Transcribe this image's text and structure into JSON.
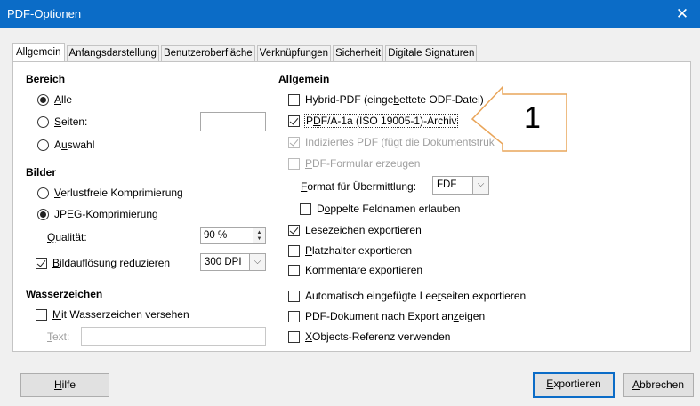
{
  "window": {
    "title": "PDF-Optionen",
    "close_symbol": "✕"
  },
  "tabs": [
    {
      "label": "Allgemein"
    },
    {
      "label": "Anfangsdarstellung"
    },
    {
      "label": "Benutzeroberfläche"
    },
    {
      "label": "Verknüpfungen"
    },
    {
      "label": "Sicherheit"
    },
    {
      "label": "Digitale Signaturen"
    }
  ],
  "left": {
    "bereich": {
      "heading": "Bereich",
      "alle": {
        "pre": "",
        "key": "A",
        "post": "lle",
        "selected": true
      },
      "seiten": {
        "pre": "",
        "key": "S",
        "post": "eiten:",
        "value": ""
      },
      "auswahl": {
        "pre": "A",
        "key": "u",
        "post": "swahl"
      }
    },
    "bilder": {
      "heading": "Bilder",
      "verlustfrei": {
        "pre": "",
        "key": "V",
        "post": "erlustfreie Komprimierung"
      },
      "jpeg": {
        "pre": "",
        "key": "J",
        "post": "PEG-Komprimierung",
        "selected": true
      },
      "qualitaet": {
        "pre": "",
        "key": "Q",
        "post": "ualität:",
        "value": "90 %"
      },
      "bildaufloesung": {
        "pre": "",
        "key": "B",
        "post": "ildauflösung reduzieren",
        "checked": true,
        "value": "300 DPI"
      }
    },
    "wasserzeichen": {
      "heading": "Wasserzeichen",
      "mit": {
        "pre": "",
        "key": "M",
        "post": "it Wasserzeichen versehen",
        "checked": false
      },
      "text": {
        "pre": "",
        "key": "T",
        "post": "ext:",
        "value": ""
      }
    }
  },
  "right": {
    "heading": "Allgemein",
    "hybrid": {
      "pre": "Hybrid-PDF (einge",
      "key": "b",
      "post": "ettete ODF-Datei)",
      "checked": false
    },
    "pdfa": {
      "pre": "P",
      "key": "D",
      "post": "F/A-1a (ISO 19005-1)-Archiv",
      "checked": true
    },
    "indiziert": {
      "pre": "",
      "key": "I",
      "post": "ndiziertes PDF (fügt die Dokumentstruk",
      "checked": true,
      "disabled": true
    },
    "formular": {
      "pre": "",
      "key": "P",
      "post": "DF-Formular erzeugen",
      "checked": false,
      "disabled": true
    },
    "format": {
      "pre": "",
      "key": "F",
      "post": "ormat für Übermittlung:",
      "value": "FDF"
    },
    "doppelte": {
      "pre": "D",
      "key": "o",
      "post": "ppelte Feldnamen erlauben",
      "checked": false
    },
    "lesezeichen": {
      "pre": "",
      "key": "L",
      "post": "esezeichen exportieren",
      "checked": true
    },
    "platzhalter": {
      "pre": "",
      "key": "P",
      "post": "latzhalter exportieren",
      "checked": false
    },
    "kommentare": {
      "pre": "",
      "key": "K",
      "post": "ommentare exportieren",
      "checked": false
    },
    "leerseiten": {
      "pre": "Automatisch eingefügte Lee",
      "key": "r",
      "post": "seiten exportieren",
      "checked": false
    },
    "anzeigen": {
      "pre": "PDF-Dokument nach Export an",
      "key": "z",
      "post": "eigen",
      "checked": false
    },
    "xobjects": {
      "pre": "",
      "key": "X",
      "post": "Objects-Referenz verwenden",
      "checked": false
    }
  },
  "callout": {
    "number": "1",
    "colors": {
      "border": "#e9a55a",
      "fill": "#ffffff"
    }
  },
  "buttons": {
    "hilfe": {
      "pre": "",
      "key": "H",
      "post": "ilfe"
    },
    "exportieren": {
      "pre": "",
      "key": "E",
      "post": "xportieren"
    },
    "abbrechen": {
      "pre": "",
      "key": "A",
      "post": "bbrechen"
    }
  },
  "colors": {
    "titlebar": "#0b6cc7",
    "dialog_bg": "#f0f0f0",
    "panel_bg": "#ffffff",
    "disabled_text": "#a0a0a0"
  }
}
